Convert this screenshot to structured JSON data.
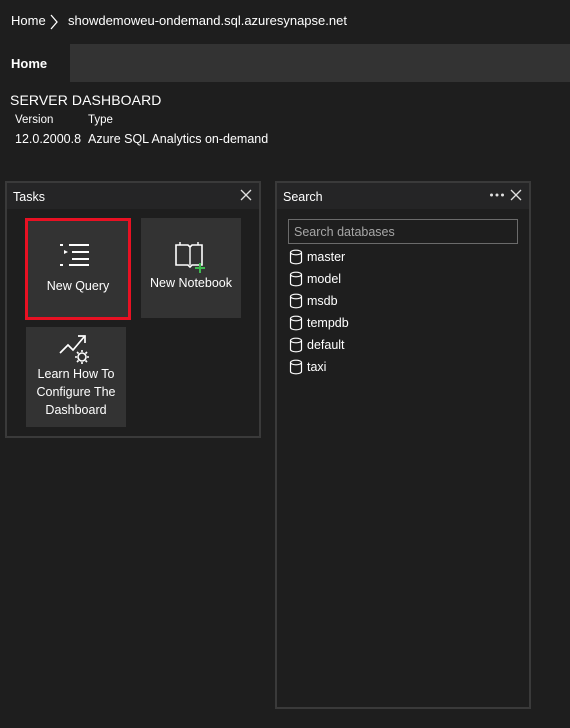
{
  "breadcrumb": {
    "home": "Home",
    "server": "showdemoweu-ondemand.sql.azuresynapse.net"
  },
  "tabs": [
    {
      "label": "Home"
    }
  ],
  "dashboard": {
    "title": "SERVER DASHBOARD",
    "version_label": "Version",
    "version_value": "12.0.2000.8",
    "type_label": "Type",
    "type_value": "Azure SQL Analytics on-demand"
  },
  "tasks": {
    "title": "Tasks",
    "items": [
      {
        "label": "New Query",
        "icon": "new-query-icon"
      },
      {
        "label": "New Notebook",
        "icon": "notebook-icon"
      },
      {
        "label_lines": [
          "Learn How To",
          "Configure The",
          "Dashboard"
        ],
        "icon": "configure-icon"
      }
    ]
  },
  "search": {
    "title": "Search",
    "placeholder": "Search databases",
    "value": "",
    "databases": [
      "master",
      "model",
      "msdb",
      "tempdb",
      "default",
      "taxi"
    ]
  },
  "colors": {
    "background": "#1e1e1e",
    "tabbar": "#333333",
    "tile": "#333333",
    "highlight": "#e81123",
    "accent_plus": "#3fb950"
  }
}
